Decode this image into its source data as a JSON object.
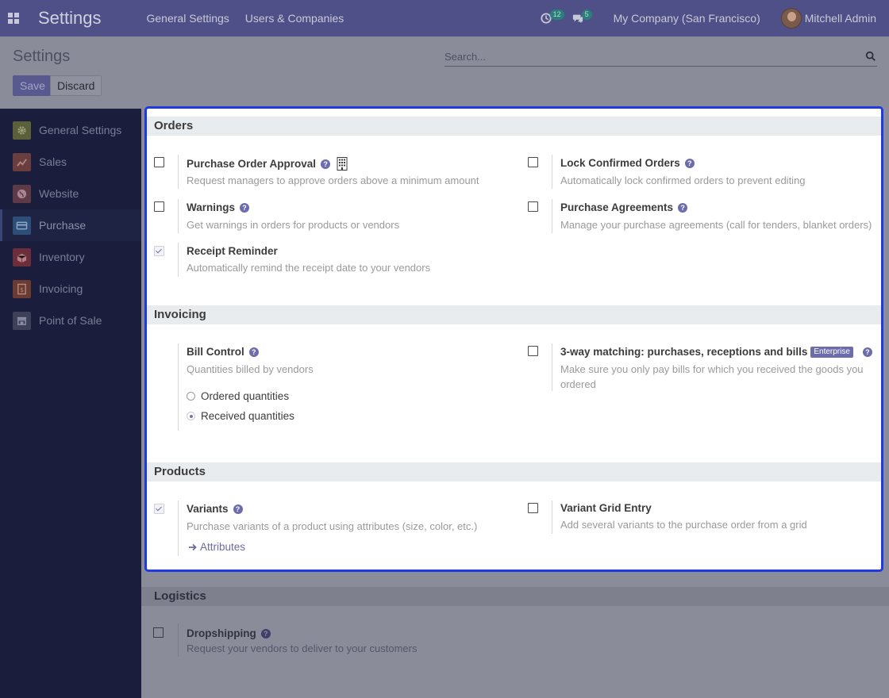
{
  "navbar": {
    "app_title": "Settings",
    "menu": [
      "General Settings",
      "Users & Companies"
    ],
    "activity_count": "12",
    "messages_count": "5",
    "company": "My Company (San Francisco)",
    "user": "Mitchell Admin"
  },
  "control_panel": {
    "title": "Settings",
    "search_placeholder": "Search...",
    "save_label": "Save",
    "discard_label": "Discard"
  },
  "sidebar": {
    "items": [
      {
        "label": "General Settings",
        "icon": "gear-icon",
        "color": "#5b5f3a"
      },
      {
        "label": "Sales",
        "icon": "chart-icon",
        "color": "#6a3e3e"
      },
      {
        "label": "Website",
        "icon": "globe-icon",
        "color": "#5e3a47"
      },
      {
        "label": "Purchase",
        "icon": "card-icon",
        "color": "#2d4f77"
      },
      {
        "label": "Inventory",
        "icon": "box-icon",
        "color": "#6b2e3a"
      },
      {
        "label": "Invoicing",
        "icon": "invoice-icon",
        "color": "#6a3b30"
      },
      {
        "label": "Point of Sale",
        "icon": "store-icon",
        "color": "#3d4058"
      }
    ],
    "active": "Purchase"
  },
  "orders": {
    "heading": "Orders",
    "po_approval": {
      "title": "Purchase Order Approval",
      "desc": "Request managers to approve orders above a minimum amount",
      "checked": false
    },
    "lock_orders": {
      "title": "Lock Confirmed Orders",
      "desc": "Automatically lock confirmed orders to prevent editing",
      "checked": false
    },
    "warnings": {
      "title": "Warnings",
      "desc": "Get warnings in orders for products or vendors",
      "checked": false
    },
    "agreements": {
      "title": "Purchase Agreements",
      "desc": "Manage your purchase agreements (call for tenders, blanket orders)",
      "checked": false
    },
    "receipt_reminder": {
      "title": "Receipt Reminder",
      "desc": "Automatically remind the receipt date to your vendors",
      "checked": true
    }
  },
  "invoicing": {
    "heading": "Invoicing",
    "bill_control": {
      "title": "Bill Control",
      "desc": "Quantities billed by vendors",
      "option_ordered": "Ordered quantities",
      "option_received": "Received quantities",
      "selected": "Received quantities"
    },
    "three_way": {
      "title": "3-way matching: purchases, receptions and bills",
      "badge": "Enterprise",
      "desc": "Make sure you only pay bills for which you received the goods you ordered",
      "checked": false
    }
  },
  "products": {
    "heading": "Products",
    "variants": {
      "title": "Variants",
      "desc": "Purchase variants of a product using attributes (size, color, etc.)",
      "link": "Attributes",
      "checked": true
    },
    "grid_entry": {
      "title": "Variant Grid Entry",
      "desc": "Add several variants to the purchase order from a grid",
      "checked": false
    }
  },
  "logistics": {
    "heading": "Logistics",
    "dropshipping": {
      "title": "Dropshipping",
      "desc": "Request your vendors to deliver to your customers",
      "checked": false
    }
  },
  "colors": {
    "navbar": "#4f5087",
    "sidebar": "#1a1e3c",
    "accent": "#6c6cad",
    "highlight_border": "#1f3adf"
  }
}
